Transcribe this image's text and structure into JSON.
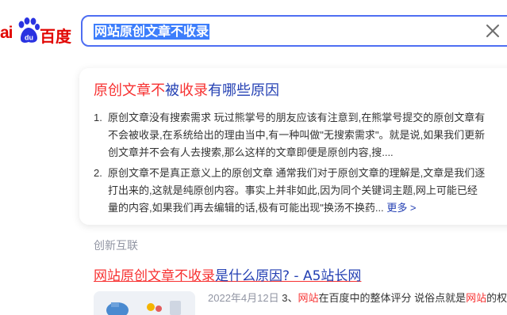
{
  "logo": {
    "left_text": "ai",
    "paw_text": "du",
    "brand_text": "百度"
  },
  "search": {
    "query": "网站原创文章不收录"
  },
  "card": {
    "title_segments": [
      {
        "text": "原创文章不",
        "hl": true
      },
      {
        "text": "被",
        "hl": false
      },
      {
        "text": "收录",
        "hl": true
      },
      {
        "text": "有哪些原因",
        "hl": false
      }
    ],
    "items": [
      {
        "num": "1.",
        "lines": [
          "原创文章没有搜索需求 玩过熊掌号的朋友应该有注意到,在熊掌号提交的原创文章有",
          "不会被收录,在系统给出的理由当中,有一种叫做\"无搜索需求\"。就是说,如果我们更新",
          "创文章并不会有人去搜索,那么这样的文章即便是原创内容,搜...."
        ]
      },
      {
        "num": "2.",
        "lines": [
          "原创文章不是真正意义上的原创文章 通常我们对于原创文章的理解是,文章是我们逐",
          "打出来的,这就是纯原创内容。事实上并非如此,因为同个关键词主题,网上可能已经",
          "量的内容,如果我们再去编辑的话,极有可能出现\"换汤不换药..."
        ],
        "more": "更多 >"
      }
    ]
  },
  "source": {
    "name": "创新互联"
  },
  "result": {
    "title_segments": [
      {
        "text": "网站原创文章不收录",
        "hl": true
      },
      {
        "text": "是什么原因? - A5站长网",
        "hl": false
      }
    ],
    "date": "2022年4月12日",
    "snippet_segments": [
      {
        "text": " 3、",
        "hl": false
      },
      {
        "text": "网站",
        "hl": true
      },
      {
        "text": "在百度中的整体评分 说俗点就是",
        "hl": false
      },
      {
        "text": "网站",
        "hl": true
      },
      {
        "text": "的权",
        "hl": false
      }
    ]
  },
  "colors": {
    "brand_red": "#e10602",
    "highlight_red": "#f73131",
    "link_blue": "#2440b3",
    "search_border": "#4e6ef2"
  }
}
